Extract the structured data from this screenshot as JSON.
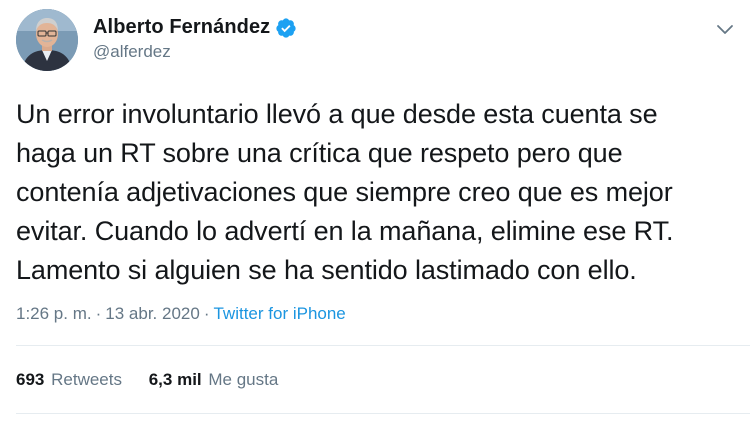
{
  "tweet": {
    "author": {
      "display_name": "Alberto Fernández",
      "handle": "@alferdez",
      "verified": true
    },
    "text": "Un error involuntario llevó a que desde esta cuenta se\nhaga un RT sobre una crítica que respeto pero que\ncontenía adjetivaciones que siempre creo que es mejor\nevitar. Cuando lo advertí en la mañana, elimine ese RT.\nLamento si alguien se ha sentido lastimado con ello.",
    "time": "1:26 p. m.",
    "separator": "·",
    "date": "13 abr. 2020",
    "source": "Twitter for iPhone",
    "stats": {
      "retweets_count": "693",
      "retweets_label": "Retweets",
      "likes_count": "6,3 mil",
      "likes_label": "Me gusta"
    }
  },
  "icons": {
    "verified": "verified-badge-icon",
    "more": "chevron-down-icon"
  },
  "colors": {
    "text": "#14171a",
    "secondary": "#657786",
    "accent": "#1b95e0",
    "verified": "#1da1f2",
    "divider": "#e6ecf0"
  }
}
